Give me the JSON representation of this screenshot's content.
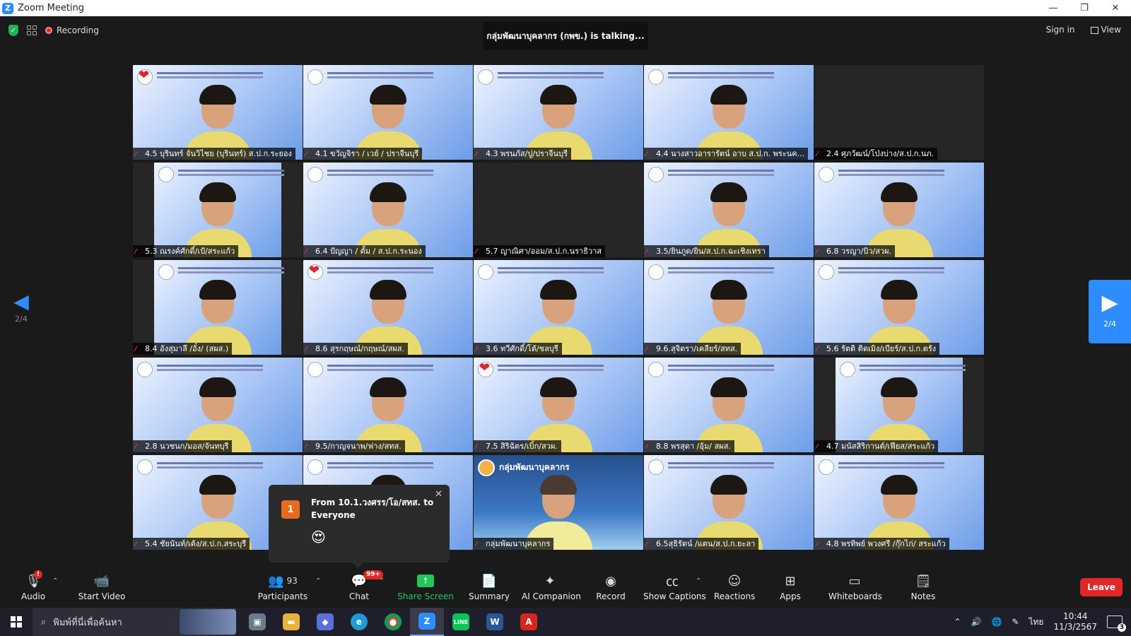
{
  "window": {
    "title": "Zoom Meeting",
    "logo_letter": "Z",
    "minimize": "—",
    "maximize": "❐",
    "close": "✕"
  },
  "topbar": {
    "recording_label": "Recording",
    "talking_text": "กลุ่มพัฒนาบุคลากร (กพข.) is talking...",
    "sign_in": "Sign in",
    "view": "View"
  },
  "paging": {
    "left_page": "2/4",
    "right_page": "2/4"
  },
  "tiles": [
    {
      "name": "4.5 บุรินทร์ จันวิไชย (บุรินทร์) ส.ป.ก.ระยอง",
      "kind": "video",
      "heart": true
    },
    {
      "name": "4.1 ขวัญจิรา / เวย์ / ปราจีนบุรี",
      "kind": "video",
      "heart": false
    },
    {
      "name": "4.3 พรนภัส/ปู/ปราจีนบุรี",
      "kind": "video",
      "heart": false
    },
    {
      "name": "4.4 นางสาวอารารัตน์ อาบ ส.ป.ก. พระนค...",
      "kind": "video",
      "heart": false
    },
    {
      "name": "2.4 ศุภวัฒน์/โป่งบ่าง/ส.ป.ก.นภ.",
      "kind": "dark",
      "heart": false
    },
    {
      "name": "5.3 ณรงค์ศักดิ์/เป้/สระแก้ว",
      "kind": "letter",
      "heart": false
    },
    {
      "name": "6.4 ปัญญา / ตั้ม / ส.ป.ก.ระนอง",
      "kind": "video",
      "heart": false
    },
    {
      "name": "5.7 ญาณิศา/ออม/ส.ป.ก.นราธิวาส",
      "kind": "dark",
      "heart": false
    },
    {
      "name": "3.5/ยินภูด/ยิน/ส.ป.ก.ฉะเชิงเทรา",
      "kind": "video",
      "heart": false
    },
    {
      "name": "6.8 วรญา/บิว/สวผ.",
      "kind": "video",
      "heart": false
    },
    {
      "name": "8.4 อังสุมาลี /อั๋ง/ (สผส.)",
      "kind": "letter",
      "heart": false
    },
    {
      "name": "8.6 สุรกฤษณ์/กฤษณ์/สผส.",
      "kind": "video",
      "heart": true
    },
    {
      "name": "3.6 ทวีศักดิ์/โต้/ชลบุรี",
      "kind": "video",
      "heart": false
    },
    {
      "name": "9.6.สุจิตรา/เคลียร์/สทส.",
      "kind": "video",
      "heart": false
    },
    {
      "name": "5.6 รัตติ ติดเมิง/เบียร์/ส.ป.ก.ตรัง",
      "kind": "video",
      "heart": false
    },
    {
      "name": "2.8 นวชนก/มอส/จันทบุรี",
      "kind": "video",
      "heart": false
    },
    {
      "name": "9.5/กาญจนาพ/ฟาง/สทส.",
      "kind": "video",
      "heart": false
    },
    {
      "name": "7.5 สิริฉัตร/เบิ้ก/สวผ.",
      "kind": "video",
      "heart": true
    },
    {
      "name": "8.8 พรสุดา /อุ้ม/ สผส.",
      "kind": "video",
      "heart": false
    },
    {
      "name": "4.7 มนัสสิริกานต์/เฟียส/สระแก้ว",
      "kind": "letter",
      "heart": false
    },
    {
      "name": "5.4 ชัยนันท์/เต้ง/ส.ป.ก.สระบุรี",
      "kind": "video",
      "heart": false
    },
    {
      "name": "",
      "kind": "video",
      "heart": false
    },
    {
      "name": "กลุ่มพัฒนาบุคลากร",
      "kind": "brand",
      "heart": false,
      "brand_title": "กลุ่มพัฒนาบุคลากร"
    },
    {
      "name": "6.5สุธิรัตน์ /แตน/ส.ป.ก.ยะลา",
      "kind": "video",
      "heart": false
    },
    {
      "name": "4.8 พรทิพย์ พวงศรี /กุ๊กไก่/ สระแก้ว",
      "kind": "video",
      "heart": false
    }
  ],
  "chat_popup": {
    "badge": "1",
    "from": "From 10.1.วงศรร/โอ/สทส. to Everyone",
    "emoji": "😍",
    "close": "✕"
  },
  "toolbar": {
    "audio": "Audio",
    "start_video": "Start Video",
    "participants": "Participants",
    "participants_count": "93",
    "chat": "Chat",
    "chat_badge": "99+",
    "share_screen": "Share Screen",
    "summary": "Summary",
    "ai_companion": "AI Companion",
    "record": "Record",
    "show_captions": "Show Captions",
    "reactions": "Reactions",
    "apps": "Apps",
    "whiteboards": "Whiteboards",
    "notes": "Notes",
    "leave": "Leave"
  },
  "taskbar": {
    "search_placeholder": "พิมพ์ที่นี่เพื่อค้นหา",
    "lang": "ไทย",
    "time": "10:44",
    "date": "11/3/2567",
    "notif_count": "3"
  }
}
